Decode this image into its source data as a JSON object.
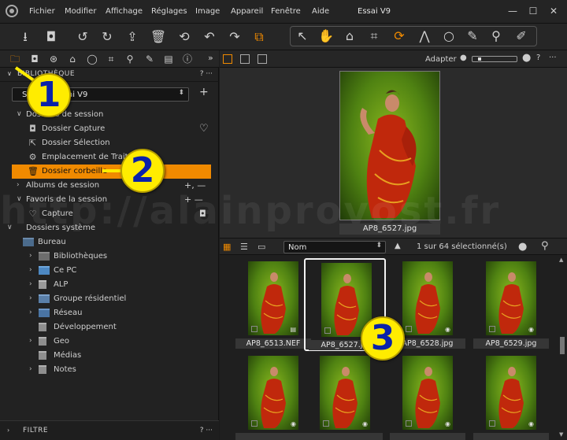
{
  "menu": {
    "items": [
      "Fichier",
      "Modifier",
      "Affichage",
      "Réglages",
      "Image",
      "Appareil",
      "Fenêtre",
      "Aide"
    ],
    "window_title": "Essai V9"
  },
  "window_controls": {
    "minimize": "—",
    "maximize": "☐",
    "close": "✕"
  },
  "toolbar": {
    "icons": [
      "import-icon",
      "capture-icon",
      "rotate-left-icon",
      "rotate-right-icon",
      "move-to-icon",
      "trash-icon",
      "undo-icon",
      "undo-one-icon",
      "redo-icon",
      "variants-icon"
    ],
    "cursor_tools": [
      "select-icon",
      "pan-icon",
      "loupe-icon",
      "crop-icon",
      "rotate-icon",
      "keystone-icon",
      "mask-icon",
      "brush-icon",
      "eyedropper-icon",
      "annotation-icon"
    ]
  },
  "left_panel": {
    "library_header": "BIBLIOTHÈQUE",
    "library_header_controls": "?  ···",
    "library_select": "Session Essai V9",
    "library_add": "+",
    "session_folders_header": "Dossiers de session",
    "session_folders": [
      {
        "label": "Dossier Capture",
        "icon": "camera-icon"
      },
      {
        "label": "Dossier Sélection",
        "icon": "selection-folder-icon"
      },
      {
        "label": "Emplacement de Traitement",
        "icon": "output-gear-icon"
      },
      {
        "label": "Dossier corbeille",
        "icon": "trash-icon"
      }
    ],
    "session_albums_header": "Albums de session",
    "session_albums_controls": "+, —",
    "session_favorites_header": "Favoris de la session",
    "session_favorites_controls": "+ —",
    "favorites": [
      {
        "label": "Capture"
      }
    ],
    "system_folders_header": "Dossiers système",
    "system_folders": [
      {
        "label": "Bureau",
        "level": 0
      },
      {
        "label": "Bibliothèques",
        "level": 1
      },
      {
        "label": "Ce PC",
        "level": 1
      },
      {
        "label": "ALP",
        "level": 1
      },
      {
        "label": "Groupe résidentiel",
        "level": 1
      },
      {
        "label": "Réseau",
        "level": 1
      },
      {
        "label": "Développement",
        "level": 1
      },
      {
        "label": "Geo",
        "level": 1
      },
      {
        "label": "Médias",
        "level": 1
      },
      {
        "label": "Notes",
        "level": 1
      }
    ],
    "filter_header": "FILTRE",
    "filter_controls": "?  ···"
  },
  "viewer": {
    "fit_label": "Adapter",
    "zoom_level": 0.1,
    "current_caption": "AP8_6527.jpg"
  },
  "browser": {
    "sort_label": "Nom",
    "selection_text": "1 sur 64 sélectionné(s)",
    "thumbnails": [
      {
        "caption": "AP8_6513.NEF",
        "badge": "▤",
        "selected": false
      },
      {
        "caption": "AP8_6527.jpg",
        "badge": "◉",
        "selected": true
      },
      {
        "caption": "AP8_6528.jpg",
        "badge": "◉",
        "selected": false
      },
      {
        "caption": "AP8_6529.jpg",
        "badge": "◉",
        "selected": false
      },
      {
        "caption": "",
        "badge": "◉",
        "selected": false
      },
      {
        "caption": "",
        "badge": "◉",
        "selected": false
      },
      {
        "caption": "",
        "badge": "◉",
        "selected": false
      },
      {
        "caption": "",
        "badge": "◉",
        "selected": false
      }
    ]
  },
  "watermark": "http://alainprovost.fr",
  "callouts": [
    "1",
    "2",
    "3"
  ],
  "colors": {
    "accent": "#f08a00",
    "callout_fill": "#ffec00",
    "callout_text": "#0a22aa",
    "panel": "#222222"
  }
}
